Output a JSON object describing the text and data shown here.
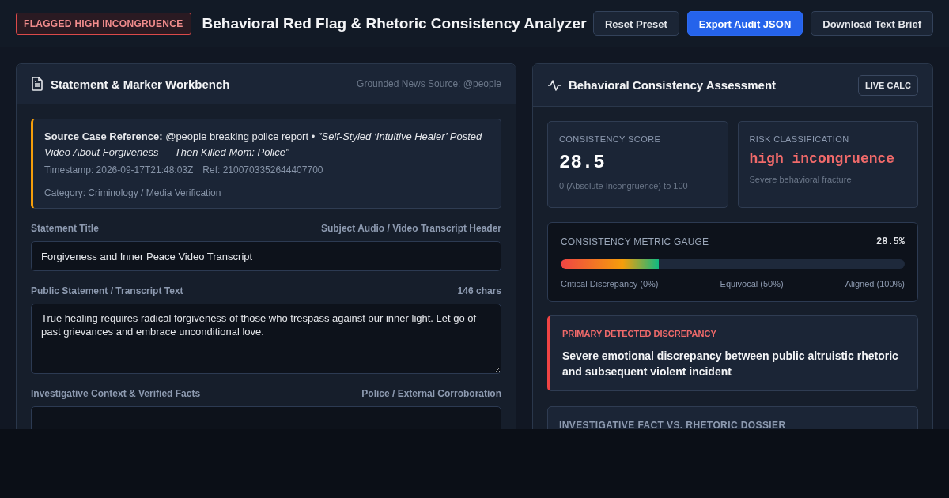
{
  "header": {
    "flag_badge": "FLAGGED HIGH INCONGRUENCE",
    "title": "Behavioral Red Flag & Rhetoric Consistency Analyzer",
    "buttons": [
      {
        "label": "Reset Preset",
        "primary": false
      },
      {
        "label": "Export Audit JSON",
        "primary": true
      },
      {
        "label": "Download Text Brief",
        "primary": false
      }
    ]
  },
  "workbench": {
    "title": "Statement & Marker Workbench",
    "source": "Grounded News Source: @people",
    "case": {
      "text": "**Source Case Reference:** @people breaking police report • *\"Self-Styled ‘Intuitive Healer’ Posted Video About Forgiveness — Then Killed Mom: Police\"*",
      "timestamp": "Timestamp: 2026-09-17T21:48:03Z",
      "ref": "Ref: 2100703352644407700",
      "category": "Category: Criminology / Media Verification"
    },
    "fields": [
      {
        "label": "Statement Title",
        "hint": "Subject Audio / Video Transcript Header",
        "kind": "input",
        "value": "Forgiveness and Inner Peace Video Transcript"
      },
      {
        "label": "Public Statement / Transcript Text",
        "hint": "146 chars",
        "kind": "textarea",
        "value": "True healing requires radical forgiveness of those who trespass against our inner light. Let go of past grievances and embrace unconditional love."
      },
      {
        "label": "Investigative Context & Verified Facts",
        "hint": "Police / External Corroboration",
        "kind": "textarea"
      }
    ]
  },
  "assessment": {
    "title": "Behavioral Consistency Assessment",
    "badge": "LIVE CALC",
    "score": {
      "label": "CONSISTENCY SCORE",
      "value": "28.5",
      "note": "0 (Absolute Incongruence) to 100"
    },
    "risk": {
      "label": "RISK CLASSIFICATION",
      "value": "high_incongruence",
      "note": "Severe behavioral fracture"
    },
    "gauge": {
      "label": "CONSISTENCY METRIC GAUGE",
      "reading": "28.5%",
      "level": 0.285,
      "scale": [
        "Critical Discrepancy (0%)",
        "Equivocal (50%)",
        "Aligned (100%)"
      ]
    },
    "discrepancy": {
      "label": "PRIMARY DETECTED DISCREPANCY",
      "text": "Severe emotional discrepancy between public altruistic rhetoric and subsequent violent incident"
    },
    "dossier": {
      "label": "INVESTIGATIVE FACT VS. RHETORIC DOSSIER"
    }
  }
}
